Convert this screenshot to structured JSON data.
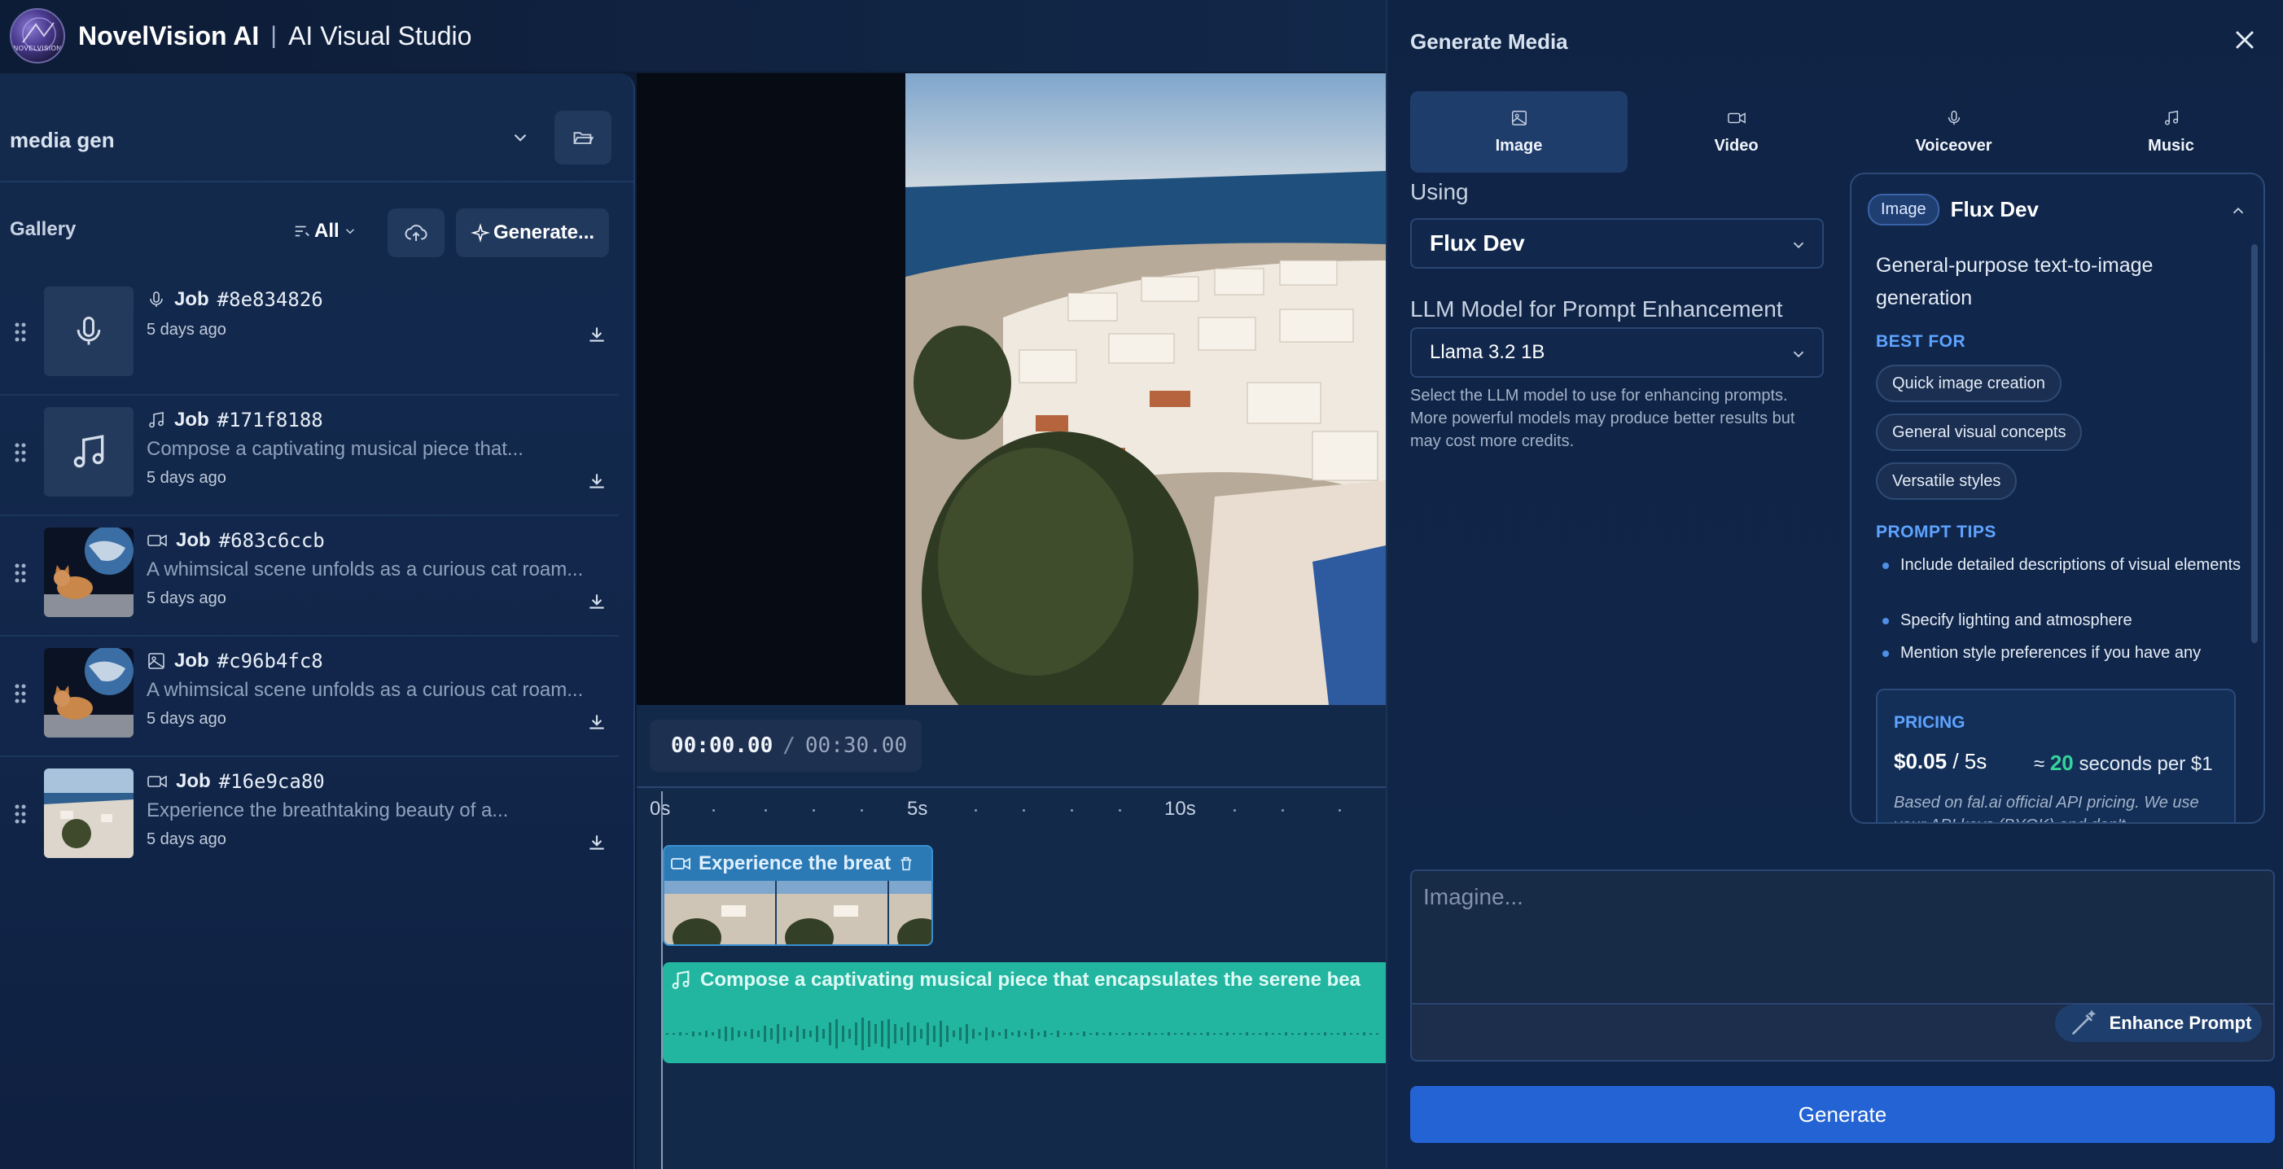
{
  "header": {
    "logo_text": "NOVELVISION",
    "brand": "NovelVision AI",
    "separator": "|",
    "subtitle": "AI Visual Studio"
  },
  "sidebar": {
    "folder_name": "media gen",
    "gallery_title": "Gallery",
    "filter_label": "All",
    "generate_label": "Generate...",
    "jobs": [
      {
        "type": "voiceover",
        "label": "Job",
        "id": "#8e834826",
        "desc": "",
        "time": "5 days ago"
      },
      {
        "type": "music",
        "label": "Job",
        "id": "#171f8188",
        "desc": "Compose a captivating musical piece that...",
        "time": "5 days ago"
      },
      {
        "type": "video",
        "label": "Job",
        "id": "#683c6ccb",
        "desc": "A whimsical scene unfolds as a curious cat roam...",
        "time": "5 days ago"
      },
      {
        "type": "image",
        "label": "Job",
        "id": "#c96b4fc8",
        "desc": "A whimsical scene unfolds as a curious cat roam...",
        "time": "5 days ago"
      },
      {
        "type": "video",
        "label": "Job",
        "id": "#16e9ca80",
        "desc": "Experience the breathtaking beauty of a...",
        "time": "5 days ago"
      }
    ]
  },
  "timeline": {
    "current": "00:00.00",
    "separator": "/",
    "total": "00:30.00",
    "ticks": [
      "0s",
      "5s",
      "10s"
    ],
    "video_clip_label": "Experience the breat",
    "audio_clip_label": "Compose a captivating musical piece that encapsulates the serene bea"
  },
  "panel": {
    "title": "Generate Media",
    "tabs": [
      {
        "label": "Image",
        "icon": "image-icon",
        "active": true
      },
      {
        "label": "Video",
        "icon": "video-icon",
        "active": false
      },
      {
        "label": "Voiceover",
        "icon": "mic-icon",
        "active": false
      },
      {
        "label": "Music",
        "icon": "music-icon",
        "active": false
      }
    ],
    "using_label": "Using",
    "model_selected": "Flux Dev",
    "llm_label": "LLM Model for Prompt Enhancement",
    "llm_selected": "Llama 3.2 1B",
    "llm_help": "Select the LLM model to use for enhancing prompts. More powerful models may produce better results but may cost more credits.",
    "model_card": {
      "badge": "Image",
      "name": "Flux Dev",
      "description": "General-purpose text-to-image generation",
      "best_for_title": "BEST FOR",
      "best_for": [
        "Quick image creation",
        "General visual concepts",
        "Versatile styles"
      ],
      "tips_title": "PROMPT TIPS",
      "tips": [
        "Include detailed descriptions of visual elements",
        "Specify lighting and atmosphere",
        "Mention style preferences if you have any"
      ],
      "pricing_title": "PRICING",
      "price": "$0.05",
      "price_unit": "/ 5s",
      "approx_prefix": "≈",
      "approx_value": "20",
      "approx_suffix": "seconds per $1",
      "pricing_note": "Based on fal.ai official API pricing. We use your API keys (BYOK) and don't"
    },
    "prompt_placeholder": "Imagine...",
    "enhance_label": "Enhance Prompt",
    "generate_label": "Generate"
  },
  "colors": {
    "accent": "#2463d4",
    "video_clip": "#2b7ab6",
    "audio_clip": "#22b5a0",
    "price_highlight": "#35d39a"
  }
}
